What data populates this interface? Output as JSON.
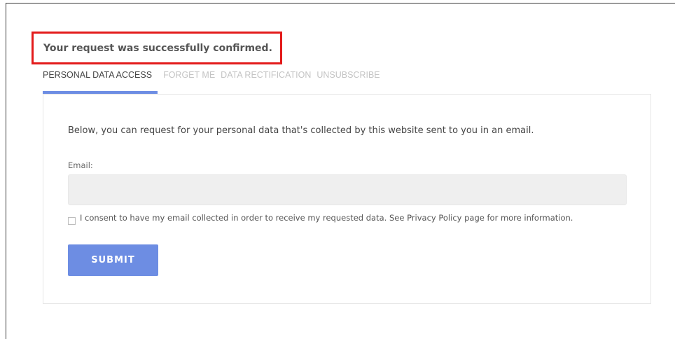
{
  "notification": {
    "message": "Your request was successfully confirmed.",
    "highlight_color": "#e31b1b"
  },
  "tabs": [
    {
      "label": "PERSONAL DATA ACCESS",
      "active": true
    },
    {
      "label": "FORGET ME",
      "active": false
    },
    {
      "label": "DATA RECTIFICATION",
      "active": false
    },
    {
      "label": "UNSUBSCRIBE",
      "active": false
    }
  ],
  "form": {
    "description": "Below, you can request for your personal data that's collected by this website sent to you in an email.",
    "email_label": "Email:",
    "email_value": "",
    "consent_text": "I consent to have my email collected in order to receive my requested data. See Privacy Policy page for more information.",
    "consent_checked": false,
    "submit_label": "SUBMIT"
  },
  "colors": {
    "accent": "#6d8de3",
    "text_primary": "#444444",
    "tab_inactive": "#c4c4c4"
  }
}
